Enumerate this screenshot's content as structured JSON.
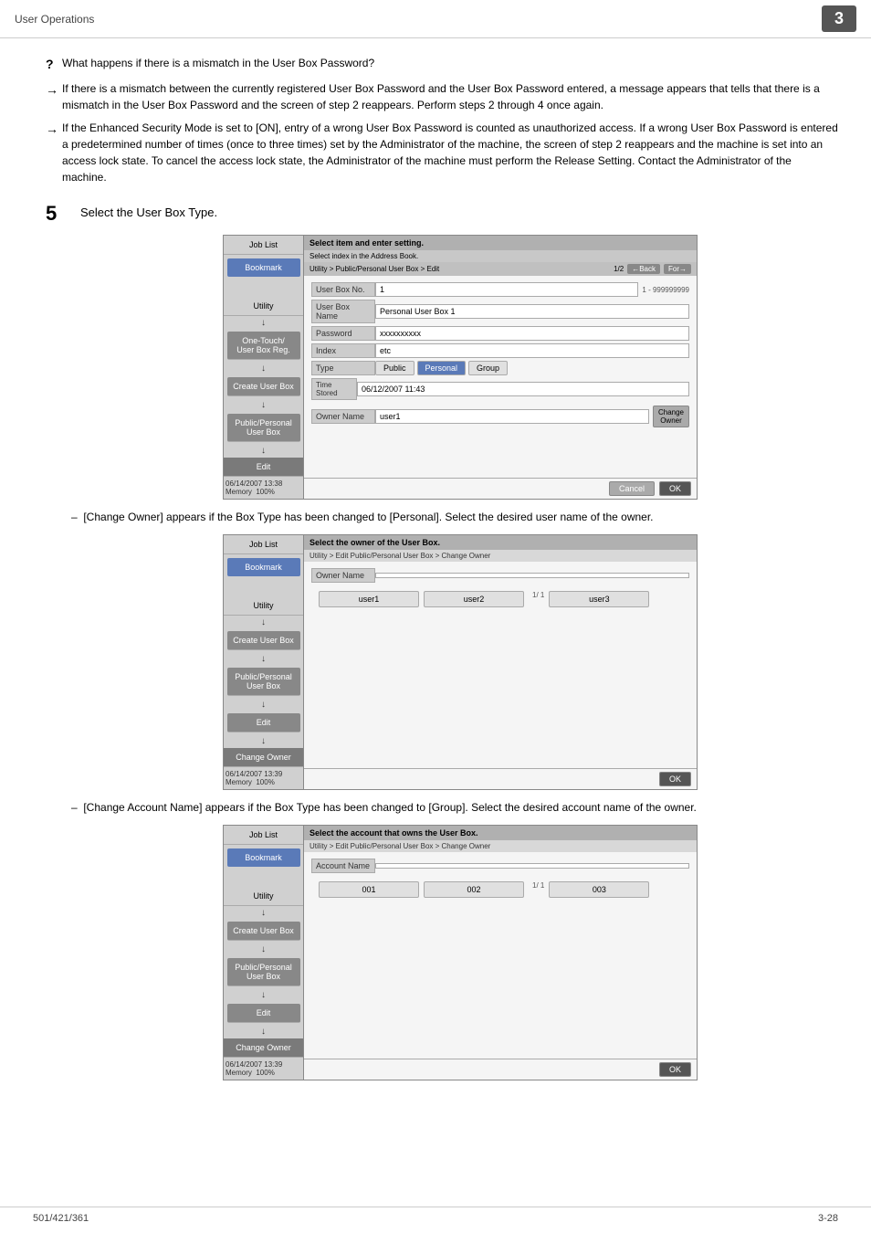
{
  "header": {
    "title": "User Operations",
    "page_badge": "3"
  },
  "bullets": {
    "question_symbol": "?",
    "question_text": "What happens if there is a mismatch in the User Box Password?",
    "arrow1_symbol": "→",
    "arrow1_text": "If there is a mismatch between the currently registered User Box Password and the User Box Password entered, a message appears that tells that there is a mismatch in the User Box Password and the screen of step 2 reappears. Perform steps 2 through 4 once again.",
    "arrow2_symbol": "→",
    "arrow2_text": "If the Enhanced Security Mode is set to [ON], entry of a wrong User Box Password is counted as unauthorized access. If a wrong User Box Password is entered a predetermined number of times (once to three times) set by the Administrator of the machine, the screen of step 2 reappears and the machine is set into an access lock state. To cancel the access lock state, the Administrator of the machine must perform the Release Setting. Contact the Administrator of the machine."
  },
  "step5": {
    "number": "5",
    "text": "Select the User Box Type."
  },
  "screen1": {
    "title": "Select item and enter setting.",
    "subtitle": "Select index in the Address Book.",
    "breadcrumb": "Utility > Public/Personal User  Box > Edit",
    "nav_page": "1/2",
    "nav_back": "←Back",
    "nav_forward": "For→",
    "fields": [
      {
        "label": "User Box No.",
        "value": "1",
        "hint": "1 - 999999999"
      },
      {
        "label": "User Box Name",
        "value": "Personal User Box 1"
      },
      {
        "label": "Password",
        "value": "xxxxxxxxxx"
      },
      {
        "label": "Index",
        "value": "etc"
      }
    ],
    "type_label": "Type",
    "type_options": [
      "Public",
      "Personal",
      "Group"
    ],
    "type_selected": "Personal",
    "time_label": "Time\nStored",
    "time_value": "06/12/2007  11:43",
    "owner_label": "Owner Name",
    "owner_value": "user1",
    "change_owner_btn": "Change\nOwner",
    "datetime": "06/14/2007   13:38",
    "memory": "Memory",
    "memory_pct": "100%",
    "cancel_btn": "Cancel",
    "ok_btn": "OK",
    "sidebar": {
      "job_list": "Job List",
      "bookmark": "Bookmark",
      "utility": "Utility",
      "one_touch": "One-Touch/\nUser Box Reg.",
      "create_user_box": "Create User Box",
      "public_personal": "Public/Personal\nUser Box",
      "edit": "Edit"
    }
  },
  "dash1": {
    "text": "[Change Owner] appears if the Box Type has been changed to [Personal]. Select the desired user name of the owner."
  },
  "screen2": {
    "title": "Select the owner of the User Box.",
    "breadcrumb": "Utility > Edit Public/Personal User Box > Change Owner",
    "owner_name_label": "Owner Name",
    "owner_name_value": "",
    "users": [
      "user1",
      "user2",
      "user3"
    ],
    "page_info": "1/  1",
    "datetime": "06/14/2007   13:39",
    "memory": "Memory",
    "memory_pct": "100%",
    "ok_btn": "OK",
    "sidebar": {
      "job_list": "Job List",
      "bookmark": "Bookmark",
      "utility": "Utility",
      "one_touch": "",
      "create_user_box": "Create User Box",
      "public_personal": "Public/Personal\nUser Box",
      "edit": "Edit",
      "change_owner": "Change Owner"
    }
  },
  "dash2": {
    "text": "[Change Account Name] appears if the Box Type has been changed to [Group]. Select the desired account name of the owner."
  },
  "screen3": {
    "title": "Select the account that owns the User Box.",
    "breadcrumb": "Utility > Edit Public/Personal User Box > Change Owner",
    "account_name_label": "Account Name",
    "account_name_value": "",
    "accounts": [
      "001",
      "002",
      "003"
    ],
    "page_info": "1/  1",
    "datetime": "06/14/2007   13:39",
    "memory": "Memory",
    "memory_pct": "100%",
    "ok_btn": "OK",
    "sidebar": {
      "job_list": "Job List",
      "bookmark": "Bookmark",
      "utility": "Utility",
      "one_touch": "",
      "create_user_box": "Create User Box",
      "public_personal": "Public/Personal\nUser Box",
      "edit": "Edit",
      "change_owner": "Change Owner"
    }
  },
  "footer": {
    "left": "501/421/361",
    "right": "3-28"
  }
}
